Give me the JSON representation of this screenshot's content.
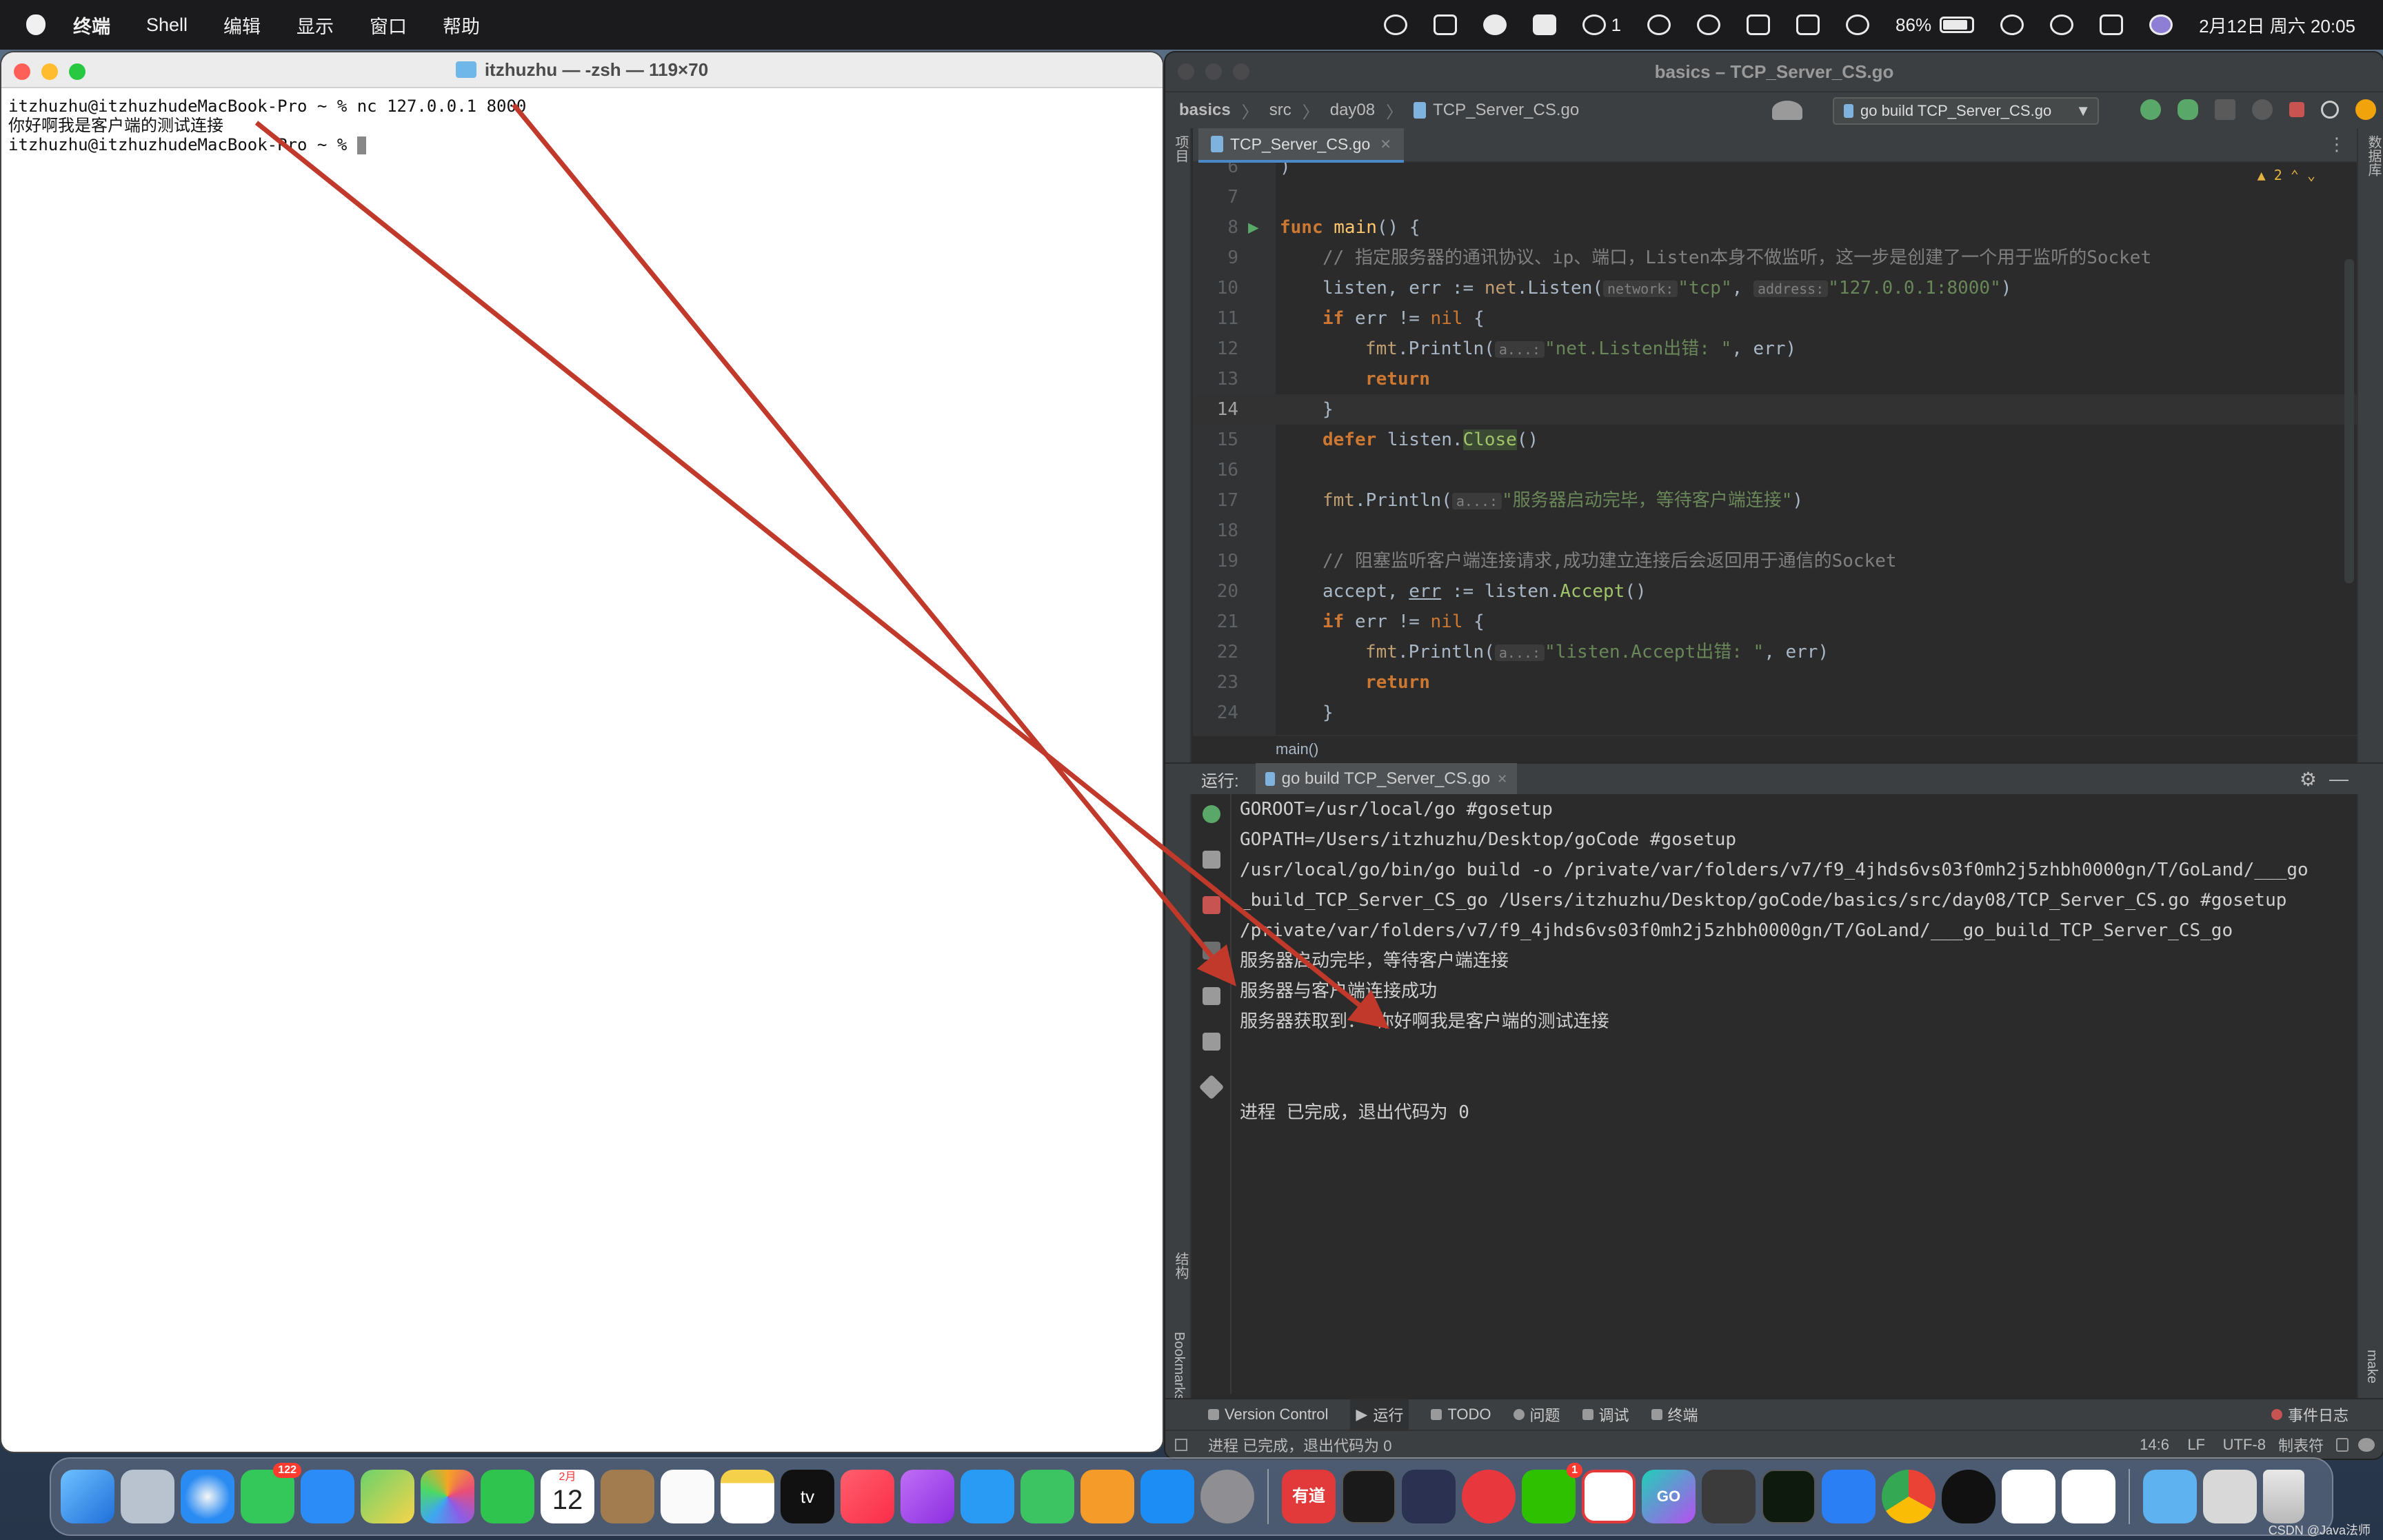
{
  "menubar": {
    "app_name": "终端",
    "items": [
      "Shell",
      "编辑",
      "显示",
      "窗口",
      "帮助"
    ],
    "wechat_count": "1",
    "battery": "86%",
    "datetime": "2月12日 周六 20:05"
  },
  "terminal": {
    "title": "itzhuzhu — -zsh — 119×70",
    "lines": [
      "itzhuzhu@itzhuzhudeMacBook-Pro ~ % nc 127.0.0.1 8000",
      "你好啊我是客户端的测试连接",
      "itzhuzhu@itzhuzhudeMacBook-Pro ~ % "
    ]
  },
  "ide": {
    "title": "basics – TCP_Server_CS.go",
    "breadcrumb": [
      "basics",
      "src",
      "day08",
      "TCP_Server_CS.go"
    ],
    "run_config": "go build TCP_Server_CS.go",
    "left_strip_project": "项目",
    "left_strip_structure": "结构",
    "left_strip_bookmarks": "Bookmarks",
    "right_strip_database": "数据库",
    "right_strip_make": "make",
    "tab": "TCP_Server_CS.go",
    "warnings": "2",
    "code_lines": {
      "l6": {
        "num": "6",
        "text": ")"
      },
      "l7": {
        "num": "7"
      },
      "l8": {
        "num": "8",
        "kw": "func",
        "name": "main",
        "rest": "() {"
      },
      "l9": {
        "num": "9",
        "comment": "// 指定服务器的通讯协议、ip、端口，Listen本身不做监听，这一步是创建了一个用于监听的Socket"
      },
      "l10": {
        "num": "10",
        "pre": "listen, err := ",
        "pkg": "net",
        "call": ".Listen(",
        "hint1": "network:",
        "s1": "\"tcp\"",
        "mid": ", ",
        "hint2": "address:",
        "s2": "\"127.0.0.1:8000\"",
        "end": ")"
      },
      "l11": {
        "num": "11",
        "kw": "if",
        "mid": " err != ",
        "nil": "nil",
        "end": " {"
      },
      "l12": {
        "num": "12",
        "pkg": "fmt",
        "call": ".Println(",
        "hint": "a...:",
        "str": "\"net.Listen出错: \"",
        "end": ", err)"
      },
      "l13": {
        "num": "13",
        "kw": "return"
      },
      "l14": {
        "num": "14",
        "text": "}"
      },
      "l15": {
        "num": "15",
        "kw": "defer",
        "pre": " listen.",
        "call": "Close",
        "end": "()"
      },
      "l16": {
        "num": "16"
      },
      "l17": {
        "num": "17",
        "pkg": "fmt",
        "call": ".Println(",
        "hint": "a...:",
        "str": "\"服务器启动完毕，等待客户端连接\"",
        "end": ")"
      },
      "l18": {
        "num": "18"
      },
      "l19": {
        "num": "19",
        "comment": "// 阻塞监听客户端连接请求,成功建立连接后会返回用于通信的Socket"
      },
      "l20": {
        "num": "20",
        "pre": "accept, ",
        "err": "err",
        "mid": " := listen.",
        "call": "Accept",
        "end": "()"
      },
      "l21": {
        "num": "21",
        "kw": "if",
        "mid": " err != ",
        "nil": "nil",
        "end": " {"
      },
      "l22": {
        "num": "22",
        "pkg": "fmt",
        "call": ".Println(",
        "hint": "a...:",
        "str": "\"listen.Accept出错: \"",
        "end": ", err)"
      },
      "l23": {
        "num": "23",
        "kw": "return"
      },
      "l24": {
        "num": "24",
        "text": "}"
      }
    },
    "editor_breadcrumb": "main()",
    "run_label": "运行:",
    "run_tab": "go build TCP_Server_CS.go",
    "console": [
      "GOROOT=/usr/local/go #gosetup",
      "GOPATH=/Users/itzhuzhu/Desktop/goCode #gosetup",
      "/usr/local/go/bin/go build -o /private/var/folders/v7/f9_4jhds6vs03f0mh2j5zhbh0000gn/T/GoLand/___go",
      "_build_TCP_Server_CS_go /Users/itzhuzhu/Desktop/goCode/basics/src/day08/TCP_Server_CS.go #gosetup",
      "/private/var/folders/v7/f9_4jhds6vs03f0mh2j5zhbh0000gn/T/GoLand/___go_build_TCP_Server_CS_go",
      "服务器启动完毕，等待客户端连接",
      "服务器与客户端连接成功",
      "服务器获取到： 你好啊我是客户端的测试连接",
      "",
      "",
      "进程 已完成，退出代码为 0"
    ],
    "bottom_tools": [
      "Version Control",
      "运行",
      "TODO",
      "问题",
      "调试",
      "终端"
    ],
    "event_log": "事件日志",
    "status_message": "进程 已完成，退出代码为 0",
    "status_right": [
      "14:6",
      "LF",
      "UTF-8",
      "制表符"
    ]
  },
  "dock": {
    "messages_badge": "122",
    "calendar_month": "2月",
    "calendar_day": "12",
    "tv_label": "tv",
    "youdao_label": "有道",
    "wechat_badge": "1",
    "go_label": "GO"
  },
  "watermark": "CSDN @Java法师",
  "colors": {
    "arrow": "#c0392b",
    "ide_bg": "#2b2b2b",
    "terminal_bg": "#ffffff",
    "accent": "#4a88c7"
  }
}
